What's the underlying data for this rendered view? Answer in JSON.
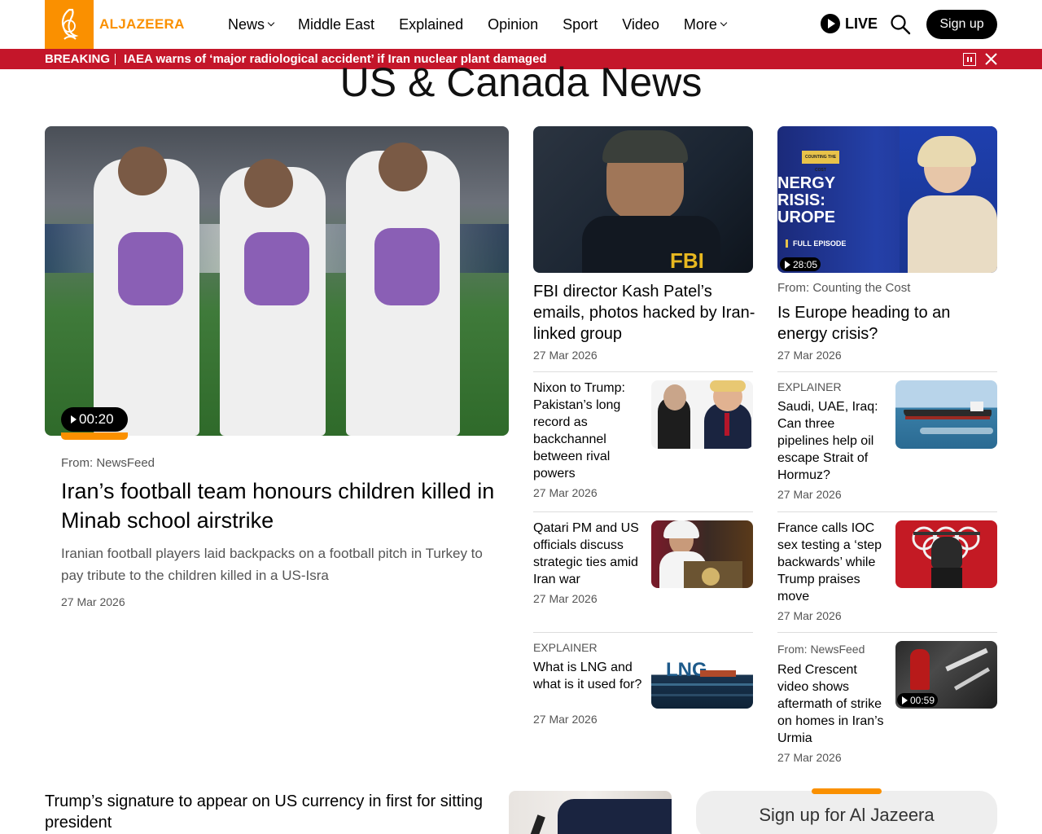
{
  "header": {
    "logo_text": "ALJAZEERA",
    "nav": [
      "News",
      "Middle East",
      "Explained",
      "Opinion",
      "Sport",
      "Video",
      "More"
    ],
    "live_label": "LIVE",
    "signup_label": "Sign up",
    "accent_color": "#fa9000"
  },
  "breaking": {
    "label": "BREAKING",
    "text": "IAEA warns of ‘major radiological accident’ if Iran nuclear plant damaged",
    "color": "#c4162a"
  },
  "page_title": "US & Canada News",
  "lead": {
    "duration": "00:20",
    "from": "From: NewsFeed",
    "title": "Iran’s football team honours children killed in Minab school airstrike",
    "summary": "Iranian football players laid backpacks on a football pitch in Turkey to pay tribute to the children killed in a US-Isra",
    "date": "27 Mar 2026"
  },
  "mid_feature": {
    "image_text": "FBI",
    "title": "FBI director Kash Patel’s emails, photos hacked by Iran-linked group",
    "date": "27 Mar 2026"
  },
  "right_feature": {
    "image_text": [
      "NERGY",
      "RISIS:",
      "UROPE"
    ],
    "badge": "COUNTING THE COST",
    "episode": "FULL EPISODE",
    "duration": "28:05",
    "from": "From: Counting the Cost",
    "title": "Is Europe heading to an energy crisis?",
    "date": "27 Mar 2026"
  },
  "mid_list": [
    {
      "kicker": "",
      "title": "Nixon to Trump: Pakistan’s long record as backchannel between rival powers",
      "date": "27 Mar 2026"
    },
    {
      "kicker": "",
      "title": "Qatari PM and US officials discuss strategic ties amid Iran war",
      "date": "27 Mar 2026"
    },
    {
      "kicker": "EXPLAINER",
      "title": "What is LNG and what is it used for?",
      "date": "27 Mar 2026",
      "image_text": "LNG"
    }
  ],
  "right_list": [
    {
      "kicker": "EXPLAINER",
      "title": "Saudi, UAE, Iraq: Can three pipelines help oil escape Strait of Hormuz?",
      "date": "27 Mar 2026"
    },
    {
      "kicker": "",
      "title": "France calls IOC sex testing a ‘step backwards’ while Trump praises move",
      "date": "27 Mar 2026"
    },
    {
      "kicker": "From: NewsFeed",
      "title": "Red Crescent video shows aftermath of strike on homes in Iran’s Urmia",
      "date": "27 Mar 2026",
      "duration": "00:59"
    }
  ],
  "bottom": {
    "title": "Trump’s signature to appear on US currency in first for sitting president",
    "signup_title": "Sign up for Al Jazeera"
  }
}
